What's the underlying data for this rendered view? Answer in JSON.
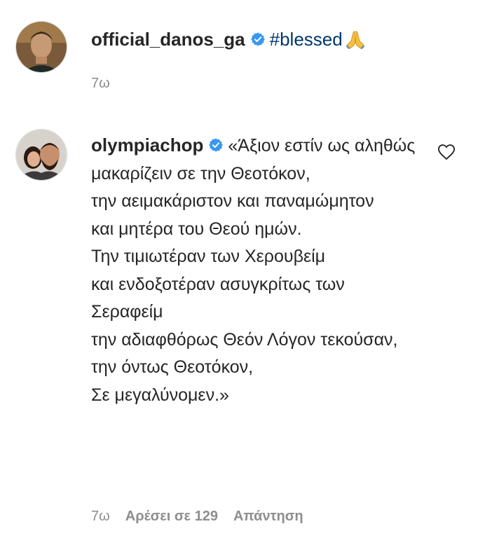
{
  "post": {
    "username": "official_danos_ga",
    "verified_icon": "verified-badge-icon",
    "caption_hashtag": "#blessed",
    "caption_emoji": "folded-hands-icon",
    "time": "7ω"
  },
  "comment": {
    "username": "olympiachop",
    "verified_icon": "verified-badge-icon",
    "text": "«Άξιον εστίν ως αληθώς\nμακαρίζειν σε την Θεοτόκον,\nτην αειμακάριστον και παναμώμητον\nκαι μητέρα του Θεού ημών.\nΤην τιμιωτέραν των Χερουβείμ\nκαι ενδοξοτέραν ασυγκρίτως των Σεραφείμ\nτην αδιαφθόρως Θεόν Λόγον τεκούσαν,\nτην όντως Θεοτόκον,\nΣε μεγαλύνομεν.»",
    "time": "7ω",
    "likes": "Αρέσει σε 129",
    "reply": "Απάντηση",
    "like_icon": "heart-icon"
  },
  "colors": {
    "text": "#262626",
    "secondary": "#8e8e8e",
    "hashtag": "#00376b",
    "verified": "#3897f0"
  }
}
